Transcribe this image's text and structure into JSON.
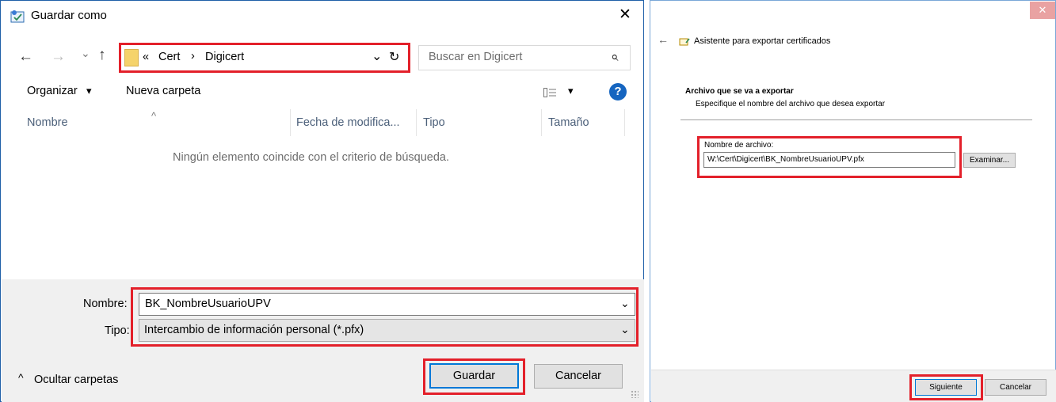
{
  "save_dialog": {
    "title": "Guardar como",
    "close_glyph": "✕",
    "nav": {
      "back": "←",
      "forward": "→",
      "recent": "⌄",
      "up": "↑"
    },
    "breadcrumb": {
      "overflow": "«",
      "sep": "›",
      "items": [
        "Cert",
        "Digicert"
      ],
      "dropdown": "⌄",
      "refresh": "↻"
    },
    "search": {
      "placeholder": "Buscar en Digicert",
      "icon": "⌕"
    },
    "toolbar": {
      "organize": "Organizar",
      "organize_arrow": "▾",
      "new_folder": "Nueva carpeta",
      "view_arrow": "▾",
      "help": "?"
    },
    "columns": {
      "sort_arrow": "^",
      "name": "Nombre",
      "date": "Fecha de modifica...",
      "type": "Tipo",
      "size": "Tamaño"
    },
    "empty_message": "Ningún elemento coincide con el criterio de búsqueda.",
    "filename": {
      "label": "Nombre:",
      "value": "BK_NombreUsuarioUPV",
      "arrow": "⌄"
    },
    "filetype": {
      "label": "Tipo:",
      "value": "Intercambio de información personal (*.pfx)",
      "arrow": "⌄"
    },
    "hide_folders": {
      "arrow": "^",
      "label": "Ocultar carpetas"
    },
    "buttons": {
      "save": "Guardar",
      "cancel": "Cancelar"
    },
    "colors": {
      "highlight": "#e3202a",
      "accent": "#0078d7"
    }
  },
  "wizard": {
    "close_glyph": "✕",
    "back": "←",
    "title": "Asistente para exportar certificados",
    "section_title": "Archivo que se va a exportar",
    "section_subtitle": "Especifique el nombre del archivo que desea exportar",
    "filename_label": "Nombre de archivo:",
    "filename_value": "W:\\Cert\\Digicert\\BK_NombreUsuarioUPV.pfx",
    "browse": "Examinar...",
    "next": "Siguiente",
    "cancel": "Cancelar"
  }
}
